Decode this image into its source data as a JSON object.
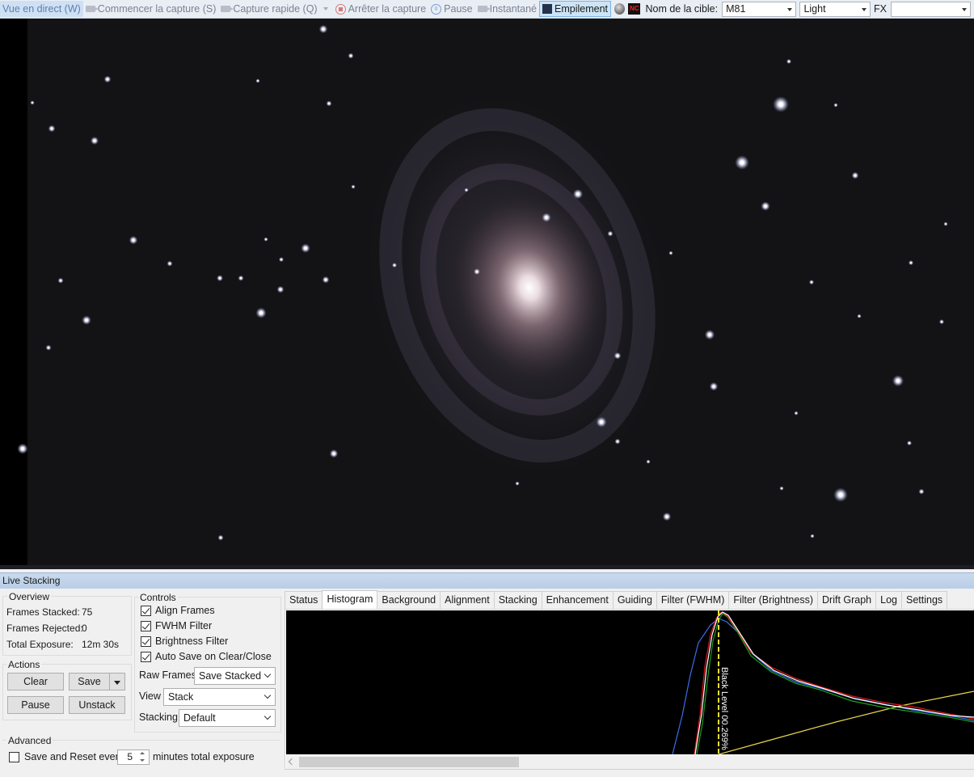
{
  "toolbar": {
    "live_view": "Vue en direct (W)",
    "start_capture": "Commencer la capture (S)",
    "quick_capture": "Capture rapide (Q)",
    "stop_capture": "Arrêter la capture",
    "pause": "Pause",
    "snapshot": "Instantané",
    "stacking": "Empilement",
    "nc_badge": "NC",
    "target_label": "Nom de la cible:",
    "target_value": "M81",
    "frame_type": "Light",
    "fx_label": "FX",
    "fx_value": ""
  },
  "live_stacking": {
    "title": "Live Stacking",
    "overview": {
      "heading": "Overview",
      "frames_stacked_label": "Frames Stacked:",
      "frames_stacked": "75",
      "frames_rejected_label": "Frames Rejected:",
      "frames_rejected": "0",
      "total_exposure_label": "Total Exposure:",
      "total_exposure": "12m 30s"
    },
    "actions": {
      "heading": "Actions",
      "clear": "Clear",
      "save": "Save",
      "pause": "Pause",
      "unstack": "Unstack"
    },
    "controls": {
      "heading": "Controls",
      "align_frames": {
        "label": "Align Frames",
        "checked": true
      },
      "fwhm_filter": {
        "label": "FWHM Filter",
        "checked": true
      },
      "brightness_filter": {
        "label": "Brightness Filter",
        "checked": true
      },
      "auto_save": {
        "label": "Auto Save on Clear/Close",
        "checked": true
      },
      "raw_frames_label": "Raw Frames",
      "raw_frames_value": "Save Stacked",
      "view_label": "View",
      "view_value": "Stack",
      "stacking_label": "Stacking",
      "stacking_value": "Default"
    },
    "advanced": {
      "heading": "Advanced",
      "save_reset_label": "Save and Reset every",
      "save_reset_checked": false,
      "minutes_value": "5",
      "minutes_suffix": "minutes total exposure"
    },
    "tabs": [
      "Status",
      "Histogram",
      "Background",
      "Alignment",
      "Stacking",
      "Enhancement",
      "Guiding",
      "Filter (FWHM)",
      "Filter (Brightness)",
      "Drift Graph",
      "Log",
      "Settings"
    ],
    "active_tab": "Histogram",
    "histogram": {
      "black_level_label": "Black Level 00.269%",
      "colors": {
        "red": "#e01818",
        "green": "#1aa01a",
        "blue": "#3a6ee8",
        "luma": "#ffffff",
        "curve": "#e8d84a",
        "marker": "#f0e030"
      }
    }
  }
}
